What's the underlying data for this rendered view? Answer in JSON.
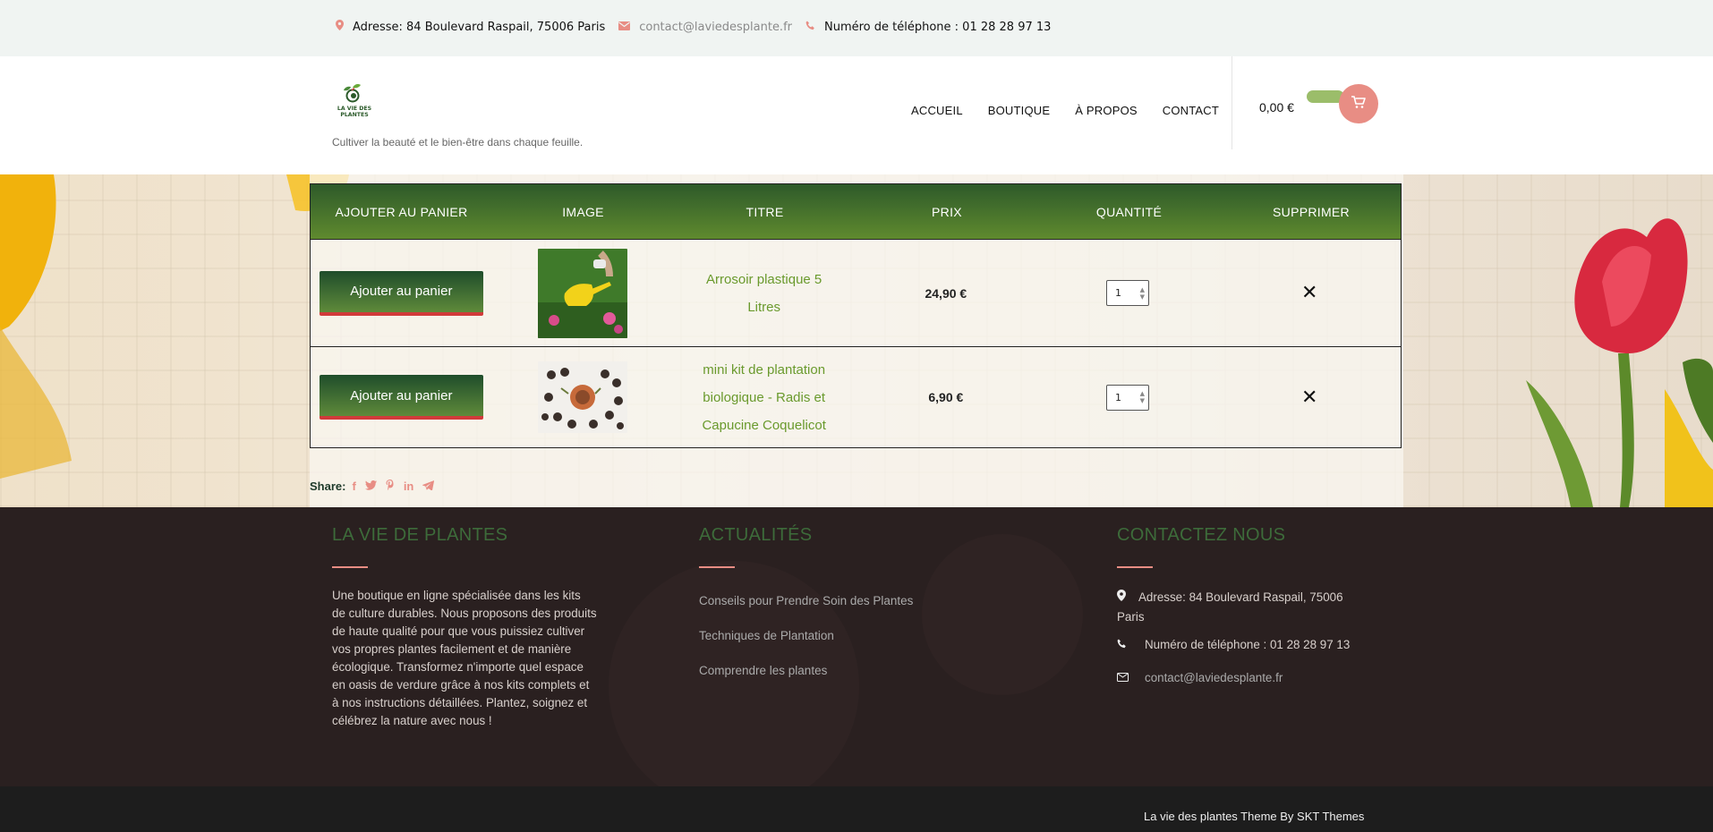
{
  "topbar": {
    "address": "Adresse: 84 Boulevard Raspail, 75006 Paris",
    "email": "contact@laviedesplante.fr",
    "phone": "Numéro de téléphone : 01 28 28 97 13"
  },
  "header": {
    "logo_text_line1": "LA VIE DES",
    "logo_text_line2": "PLANTES",
    "tagline": "Cultiver la beauté et le bien-être dans chaque feuille.",
    "nav": [
      "ACCUEIL",
      "BOUTIQUE",
      "À PROPOS",
      "CONTACT"
    ],
    "cart_total": "0,00 €"
  },
  "wishlist": {
    "columns": [
      "AJOUTER AU PANIER",
      "IMAGE",
      "TITRE",
      "PRIX",
      "QUANTITÉ",
      "SUPPRIMER"
    ],
    "rows": [
      {
        "button": "Ajouter au panier",
        "title_line1": "Arrosoir plastique 5",
        "title_line2": "Litres",
        "title_line3": "",
        "price": "24,90 €",
        "qty": "1",
        "remove": "✕"
      },
      {
        "button": "Ajouter au panier",
        "title_line1": "mini kit de plantation",
        "title_line2": "biologique - Radis et",
        "title_line3": "Capucine Coquelicot",
        "price": "6,90 €",
        "qty": "1",
        "remove": "✕"
      }
    ]
  },
  "share": {
    "label": "Share:",
    "icons": [
      "facebook-icon",
      "twitter-icon",
      "pinterest-icon",
      "linkedin-icon",
      "telegram-icon"
    ]
  },
  "footer": {
    "col1_title": "LA VIE DE PLANTES",
    "about": "Une boutique en ligne spécialisée dans les kits de culture durables. Nous proposons des produits de haute qualité pour que vous puissiez cultiver vos propres plantes facilement et de manière écologique. Transformez n'importe quel espace en oasis de verdure grâce à nos kits complets et à nos instructions détaillées. Plantez, soignez et célébrez la nature avec nous !",
    "col2_title": "ACTUALITÉS",
    "news": [
      "Conseils pour Prendre Soin des Plantes",
      "Techniques de Plantation",
      "Comprendre les plantes"
    ],
    "col3_title": "CONTACTEZ NOUS",
    "contact_address": "Adresse: 84 Boulevard Raspail, 75006 Paris",
    "contact_phone": "Numéro de téléphone : 01 28 28 97 13",
    "contact_email": "contact@laviedesplante.fr",
    "credit": "La vie des plantes Theme By SKT Themes"
  },
  "colors": {
    "accent": "#e88d84",
    "green": "#6a9a2d",
    "dark_green": "#1f4d2b",
    "footer_bg": "#2a2020"
  }
}
